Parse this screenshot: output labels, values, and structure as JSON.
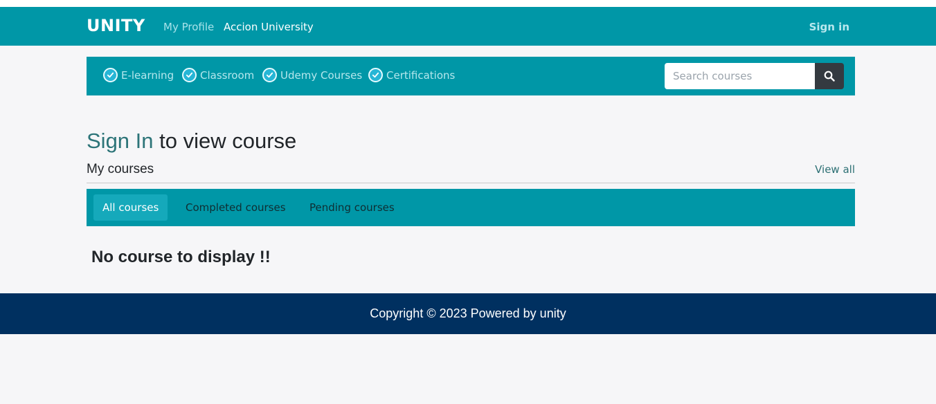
{
  "navbar": {
    "brand": "UNITY",
    "links": [
      "My Profile",
      "Accion University"
    ],
    "signin": "Sign in"
  },
  "categories": [
    {
      "label": "E-learning",
      "icon": "check-badge-icon"
    },
    {
      "label": "Classroom",
      "icon": "check-badge-icon"
    },
    {
      "label": "Udemy Courses",
      "icon": "check-badge-icon"
    },
    {
      "label": "Certifications",
      "icon": "check-badge-icon"
    }
  ],
  "search": {
    "placeholder": "Search courses",
    "value": "",
    "button_icon": "search-icon"
  },
  "main": {
    "heading_accent": "Sign In",
    "heading_rest": " to view course",
    "section_title": "My courses",
    "view_all": "View all",
    "tabs": [
      "All courses",
      "Completed courses",
      "Pending courses"
    ],
    "active_tab": "All courses",
    "empty_message": "No course to display !!"
  },
  "footer": {
    "text": "Copyright © 2023 Powered by unity"
  },
  "colors": {
    "primary": "#0097a7",
    "footer": "#003060",
    "accent_text": "#2c7478",
    "search_button": "#343a40"
  }
}
